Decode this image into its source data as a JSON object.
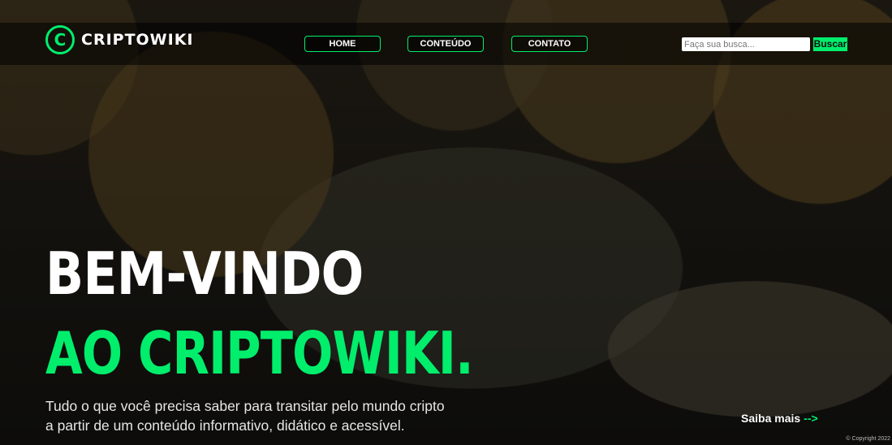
{
  "brand": {
    "logo_letter": "C",
    "name": "CRIPTOWIKI"
  },
  "nav": {
    "items": [
      {
        "label": "HOME"
      },
      {
        "label": "CONTEÚDO"
      },
      {
        "label": "CONTATO"
      }
    ]
  },
  "search": {
    "placeholder": "Faça sua busca...",
    "button_label": "Buscar"
  },
  "hero": {
    "line1": "BEM-VINDO",
    "line2": "AO CRIPTOWIKI.",
    "description_line1": "Tudo o que você precisa saber para transitar pelo mundo cripto",
    "description_line2": "a partir de um conteúdo informativo, didático e acessível.",
    "cta_label": "Saiba mais",
    "cta_arrow": "-->"
  },
  "footer": {
    "copyright": "© Copyright 2022"
  },
  "colors": {
    "accent": "#00ee6b",
    "text": "#ffffff",
    "nav_bg": "#000000"
  }
}
